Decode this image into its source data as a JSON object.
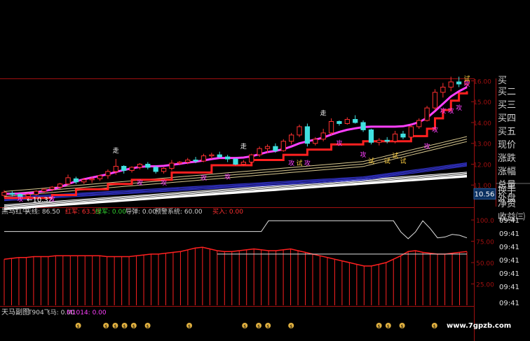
{
  "right_panel": {
    "labels": [
      "买二",
      "买三",
      "买四",
      "买五",
      "现价",
      "涨跌",
      "涨幅",
      "总量",
      "外盘",
      "换手",
      "净资",
      "收益㈢"
    ],
    "partial_top": "买"
  },
  "price_axis": {
    "ticks": [
      {
        "label": "16.00",
        "value": 16.0
      },
      {
        "label": "15.00",
        "value": 15.0
      },
      {
        "label": "14.00",
        "value": 14.0
      },
      {
        "label": "13.00",
        "value": 13.0
      },
      {
        "label": "12.00",
        "value": 12.0
      },
      {
        "label": "11.00",
        "value": 11.0
      }
    ],
    "current_price_label": "10.56",
    "current_price": 10.56,
    "low_marker": "←10.32",
    "low_marker_value": 10.32
  },
  "indicator_panel": {
    "name": "黑马红牛",
    "items": [
      {
        "text": "天线: 86.50",
        "color": "#d0d0d0"
      },
      {
        "text": "红军: 63.53",
        "color": "#ff3030"
      },
      {
        "text": "绿军: 0.00",
        "color": "#30d030"
      },
      {
        "text": "导弹: 0.00",
        "color": "#d0d0d0"
      },
      {
        "text": "预警系统: 60.00",
        "color": "#d0d0d0"
      },
      {
        "text": "买入: 0.00",
        "color": "#ff3030"
      }
    ],
    "axis_ticks": [
      {
        "label": "100.0",
        "value": 100
      },
      {
        "label": "75.00",
        "value": 75
      },
      {
        "label": "50.00",
        "value": 50
      },
      {
        "label": "25.00",
        "value": 25
      }
    ],
    "time_labels": [
      "09:41",
      "09:41",
      "09:41",
      "09:41",
      "09:41",
      "09:41"
    ]
  },
  "bottom_panel": {
    "name": "天马副图",
    "items": [
      {
        "text": "T904飞马: 0.00",
        "color": "#d0d0d0"
      },
      {
        "text": "M1014: 0.00",
        "color": "#ff40ff"
      }
    ],
    "watermark": "www.7gpzb.com",
    "time_label": "09:41"
  },
  "annotations": [
    {
      "text": "走",
      "color": "#ffffff"
    },
    {
      "text": "走",
      "color": "#ffffff"
    },
    {
      "text": "走",
      "color": "#ffffff"
    },
    {
      "text": "攻",
      "color": "#ff40ff"
    },
    {
      "text": "攻",
      "color": "#ff40ff"
    },
    {
      "text": "攻",
      "color": "#ff40ff"
    },
    {
      "text": "攻",
      "color": "#ff40ff"
    },
    {
      "text": "攻",
      "color": "#ff40ff"
    },
    {
      "text": "攻",
      "color": "#ff40ff"
    },
    {
      "text": "攻",
      "color": "#ff40ff"
    },
    {
      "text": "攻",
      "color": "#ff40ff"
    },
    {
      "text": "攻",
      "color": "#ff40ff"
    },
    {
      "text": "攻",
      "color": "#ff40ff"
    },
    {
      "text": "攻",
      "color": "#ff40ff"
    },
    {
      "text": "攻",
      "color": "#ff40ff"
    },
    {
      "text": "攻",
      "color": "#ff40ff"
    },
    {
      "text": "攻",
      "color": "#ff40ff"
    },
    {
      "text": "攻",
      "color": "#ff40ff"
    },
    {
      "text": "攻",
      "color": "#ff40ff"
    },
    {
      "text": "试",
      "color": "#ffd040"
    },
    {
      "text": "试",
      "color": "#ffd040"
    },
    {
      "text": "试",
      "color": "#ffd040"
    },
    {
      "text": "试",
      "color": "#ffd040"
    },
    {
      "text": "试",
      "color": "#ffd040"
    },
    {
      "text": "试",
      "color": "#ffd040"
    }
  ],
  "chart_data": {
    "type": "candlestick",
    "colors": {
      "up": "#ff3030",
      "down": "#40e0e0",
      "ma_magenta": "#ff40ff",
      "ma_red": "#ff2020",
      "band_gold": "#d8c890",
      "band_blue": "#3030c0",
      "band_white": "#ffffff"
    },
    "candles": [
      {
        "o": 10.5,
        "h": 10.75,
        "l": 10.4,
        "c": 10.65
      },
      {
        "o": 10.6,
        "h": 10.7,
        "l": 10.45,
        "c": 10.55
      },
      {
        "o": 10.55,
        "h": 10.6,
        "l": 10.32,
        "c": 10.45
      },
      {
        "o": 10.45,
        "h": 10.6,
        "l": 10.4,
        "c": 10.55
      },
      {
        "o": 10.55,
        "h": 10.75,
        "l": 10.5,
        "c": 10.7
      },
      {
        "o": 10.7,
        "h": 10.85,
        "l": 10.6,
        "c": 10.8
      },
      {
        "o": 10.8,
        "h": 10.95,
        "l": 10.7,
        "c": 10.9
      },
      {
        "o": 10.9,
        "h": 11.1,
        "l": 10.8,
        "c": 11.05
      },
      {
        "o": 11.05,
        "h": 11.5,
        "l": 11.0,
        "c": 11.35
      },
      {
        "o": 11.3,
        "h": 11.4,
        "l": 11.05,
        "c": 11.15
      },
      {
        "o": 11.15,
        "h": 11.35,
        "l": 11.05,
        "c": 11.25
      },
      {
        "o": 11.25,
        "h": 11.4,
        "l": 11.1,
        "c": 11.3
      },
      {
        "o": 11.3,
        "h": 11.5,
        "l": 11.2,
        "c": 11.45
      },
      {
        "o": 11.45,
        "h": 11.75,
        "l": 11.3,
        "c": 11.65
      },
      {
        "o": 11.65,
        "h": 12.25,
        "l": 11.5,
        "c": 11.9
      },
      {
        "o": 11.9,
        "h": 11.95,
        "l": 11.55,
        "c": 11.7
      },
      {
        "o": 11.7,
        "h": 11.9,
        "l": 11.6,
        "c": 11.85
      },
      {
        "o": 11.85,
        "h": 12.05,
        "l": 11.75,
        "c": 12.0
      },
      {
        "o": 12.0,
        "h": 12.1,
        "l": 11.75,
        "c": 11.85
      },
      {
        "o": 11.85,
        "h": 11.95,
        "l": 11.55,
        "c": 11.65
      },
      {
        "o": 11.65,
        "h": 11.85,
        "l": 11.55,
        "c": 11.8
      },
      {
        "o": 11.8,
        "h": 12.2,
        "l": 11.7,
        "c": 12.05
      },
      {
        "o": 12.05,
        "h": 12.15,
        "l": 11.95,
        "c": 12.1
      },
      {
        "o": 12.1,
        "h": 12.3,
        "l": 12.0,
        "c": 12.2
      },
      {
        "o": 12.2,
        "h": 12.35,
        "l": 12.05,
        "c": 12.15
      },
      {
        "o": 12.15,
        "h": 12.5,
        "l": 12.1,
        "c": 12.4
      },
      {
        "o": 12.4,
        "h": 12.55,
        "l": 12.25,
        "c": 12.45
      },
      {
        "o": 12.45,
        "h": 12.6,
        "l": 12.3,
        "c": 12.35
      },
      {
        "o": 12.35,
        "h": 12.45,
        "l": 12.1,
        "c": 12.25
      },
      {
        "o": 12.25,
        "h": 12.3,
        "l": 11.95,
        "c": 12.0
      },
      {
        "o": 12.0,
        "h": 12.2,
        "l": 11.9,
        "c": 12.1
      },
      {
        "o": 12.1,
        "h": 12.5,
        "l": 12.05,
        "c": 12.45
      },
      {
        "o": 12.45,
        "h": 12.85,
        "l": 12.35,
        "c": 12.75
      },
      {
        "o": 12.75,
        "h": 12.95,
        "l": 12.55,
        "c": 12.85
      },
      {
        "o": 12.85,
        "h": 13.0,
        "l": 12.55,
        "c": 12.65
      },
      {
        "o": 12.65,
        "h": 13.2,
        "l": 12.6,
        "c": 13.1
      },
      {
        "o": 13.1,
        "h": 13.5,
        "l": 12.95,
        "c": 13.4
      },
      {
        "o": 13.4,
        "h": 13.9,
        "l": 13.3,
        "c": 13.8
      },
      {
        "o": 13.8,
        "h": 13.95,
        "l": 12.85,
        "c": 13.0
      },
      {
        "o": 13.0,
        "h": 13.3,
        "l": 12.9,
        "c": 13.2
      },
      {
        "o": 13.2,
        "h": 13.7,
        "l": 13.1,
        "c": 13.5
      },
      {
        "o": 13.5,
        "h": 14.2,
        "l": 13.4,
        "c": 14.05
      },
      {
        "o": 14.05,
        "h": 14.1,
        "l": 13.85,
        "c": 13.95
      },
      {
        "o": 13.95,
        "h": 14.25,
        "l": 13.9,
        "c": 14.15
      },
      {
        "o": 14.15,
        "h": 14.35,
        "l": 13.95,
        "c": 14.0
      },
      {
        "o": 14.0,
        "h": 14.1,
        "l": 13.55,
        "c": 13.65
      },
      {
        "o": 13.65,
        "h": 13.7,
        "l": 12.95,
        "c": 13.05
      },
      {
        "o": 13.05,
        "h": 13.25,
        "l": 12.9,
        "c": 13.15
      },
      {
        "o": 13.15,
        "h": 13.3,
        "l": 13.0,
        "c": 13.1
      },
      {
        "o": 13.1,
        "h": 13.6,
        "l": 13.0,
        "c": 13.45
      },
      {
        "o": 13.45,
        "h": 13.6,
        "l": 13.2,
        "c": 13.3
      },
      {
        "o": 13.3,
        "h": 13.9,
        "l": 13.25,
        "c": 13.8
      },
      {
        "o": 13.8,
        "h": 14.2,
        "l": 13.7,
        "c": 14.1
      },
      {
        "o": 14.1,
        "h": 14.8,
        "l": 14.05,
        "c": 14.7
      },
      {
        "o": 14.7,
        "h": 15.6,
        "l": 14.6,
        "c": 15.45
      },
      {
        "o": 15.45,
        "h": 15.9,
        "l": 15.2,
        "c": 15.7
      },
      {
        "o": 15.7,
        "h": 16.2,
        "l": 15.5,
        "c": 15.95
      },
      {
        "o": 15.95,
        "h": 16.2,
        "l": 15.7,
        "c": 15.85
      },
      {
        "o": 15.85,
        "h": 16.1,
        "l": 15.7,
        "c": 16.0
      }
    ],
    "ma_magenta": [
      10.58,
      10.58,
      10.59,
      10.61,
      10.65,
      10.71,
      10.79,
      10.9,
      11.05,
      11.18,
      11.28,
      11.36,
      11.44,
      11.52,
      11.63,
      11.72,
      11.8,
      11.87,
      11.9,
      11.9,
      11.92,
      11.97,
      12.02,
      12.08,
      12.12,
      12.18,
      12.25,
      12.3,
      12.3,
      12.3,
      12.32,
      12.38,
      12.48,
      12.58,
      12.64,
      12.72,
      12.85,
      13.0,
      13.1,
      13.18,
      13.28,
      13.42,
      13.55,
      13.65,
      13.72,
      13.78,
      13.8,
      13.8,
      13.8,
      13.8,
      13.82,
      13.9,
      14.02,
      14.22,
      14.55,
      14.9,
      15.25,
      15.5,
      15.7
    ],
    "ma_red": [
      10.38,
      10.38,
      10.38,
      10.38,
      10.38,
      10.38,
      10.52,
      10.52,
      10.52,
      10.8,
      10.8,
      10.8,
      10.8,
      11.05,
      11.05,
      11.05,
      11.25,
      11.25,
      11.25,
      11.25,
      11.25,
      11.6,
      11.6,
      11.6,
      11.6,
      11.6,
      11.95,
      11.95,
      11.95,
      11.95,
      11.95,
      12.2,
      12.2,
      12.2,
      12.2,
      12.45,
      12.45,
      12.45,
      12.7,
      12.7,
      12.7,
      12.95,
      12.95,
      12.95,
      12.95,
      13.1,
      13.1,
      13.1,
      13.1,
      13.1,
      13.1,
      13.35,
      13.35,
      13.7,
      14.2,
      14.6,
      15.05,
      15.4,
      15.5
    ],
    "indicator": {
      "tianxian": [
        86.5,
        86.5,
        86.5,
        86.5,
        86.5,
        86.5,
        86.5,
        86.5,
        86.5,
        86.5,
        86.5,
        86.5,
        86.5,
        86.5,
        86.5,
        86.5,
        86.5,
        86.5,
        86.5,
        86.5,
        86.5,
        86.5,
        86.5,
        86.5,
        86.5,
        86.5,
        86.5,
        86.5,
        86.5,
        86.5,
        86.5,
        86.5,
        86.5,
        86.5,
        86.5,
        86.5,
        99,
        99,
        99,
        99,
        99,
        99,
        99,
        99,
        99,
        99,
        99,
        99,
        99,
        99,
        99,
        99,
        99,
        99,
        86,
        78,
        86,
        99,
        90,
        79,
        80,
        83,
        82,
        79
      ],
      "yujing": 60.0,
      "hongjun": [
        54,
        55,
        56,
        56,
        57,
        57,
        57,
        58,
        58,
        58,
        58,
        58,
        58,
        58,
        57,
        57,
        57,
        57,
        58,
        59,
        60,
        60,
        61,
        62,
        63,
        65,
        67,
        68,
        66,
        64,
        63,
        63,
        64,
        65,
        66,
        65,
        64,
        64,
        65,
        66,
        64,
        62,
        60,
        58,
        56,
        54,
        52,
        50,
        48,
        46,
        46,
        48,
        50,
        54,
        58,
        63,
        64,
        62,
        61,
        60,
        60,
        61,
        62,
        63
      ]
    },
    "bottom_markers": [
      0.16,
      0.22,
      0.24,
      0.26,
      0.28,
      0.31,
      0.4,
      0.52,
      0.55,
      0.57,
      0.62,
      0.81,
      0.83,
      0.86,
      0.93
    ]
  }
}
